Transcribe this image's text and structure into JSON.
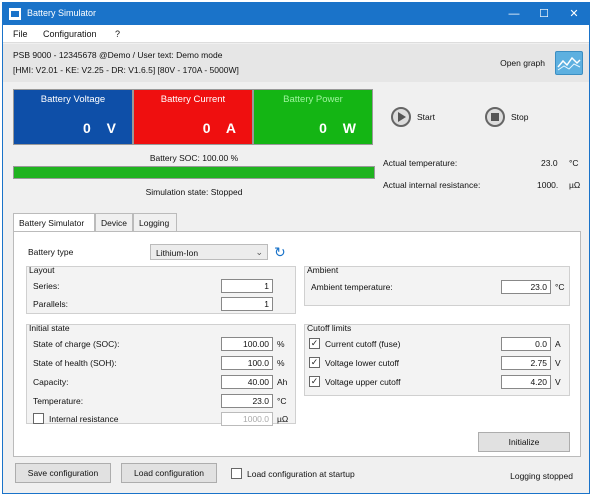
{
  "window": {
    "title": "Battery Simulator"
  },
  "menu": [
    "File",
    "Configuration",
    "?"
  ],
  "info": {
    "line1": "PSB 9000 - 12345678 @Demo / User text: Demo mode",
    "line2": "[HMI: V2.01 - KE: V2.25 - DR: V1.6.5] [80V - 170A - 5000W]",
    "open_graph": "Open graph"
  },
  "meters": [
    {
      "label": "Battery Voltage",
      "value": "0",
      "unit": "V",
      "color": "#0e4fa8",
      "label_color": "#ffffff"
    },
    {
      "label": "Battery Current",
      "value": "0",
      "unit": "A",
      "color": "#ef0f0f",
      "label_color": "#ffffff"
    },
    {
      "label": "Battery Power",
      "value": "0",
      "unit": "W",
      "color": "#14b514",
      "label_color": "#9ff59f"
    }
  ],
  "controls": {
    "start": "Start",
    "stop": "Stop"
  },
  "soc": {
    "label": "Battery SOC: 100.00 %",
    "percent": 100
  },
  "sim_state": "Simulation state: Stopped",
  "actuals": {
    "temp_label": "Actual temperature:",
    "temp_value": "23.0",
    "temp_unit": "°C",
    "res_label": "Actual internal resistance:",
    "res_value": "1000.",
    "res_unit": "µΩ"
  },
  "tabs": [
    "Battery Simulator",
    "Device",
    "Logging"
  ],
  "battery_type": {
    "label": "Battery type",
    "value": "Lithium-Ion"
  },
  "layout": {
    "title": "Layout",
    "series_label": "Series:",
    "series_value": "1",
    "parallels_label": "Parallels:",
    "parallels_value": "1"
  },
  "initial": {
    "title": "Initial state",
    "rows": [
      {
        "label": "State of charge (SOC):",
        "value": "100.00",
        "unit": "%"
      },
      {
        "label": "State of health (SOH):",
        "value": "100.0",
        "unit": "%"
      },
      {
        "label": "Capacity:",
        "value": "40.00",
        "unit": "Ah"
      },
      {
        "label": "Temperature:",
        "value": "23.0",
        "unit": "°C"
      }
    ],
    "ir_label": "Internal resistance",
    "ir_value": "1000.0",
    "ir_unit": "µΩ"
  },
  "ambient": {
    "title": "Ambient",
    "label": "Ambient temperature:",
    "value": "23.0",
    "unit": "°C"
  },
  "cutoff": {
    "title": "Cutoff limits",
    "rows": [
      {
        "label": "Current cutoff (fuse)",
        "value": "0.0",
        "unit": "A"
      },
      {
        "label": "Voltage lower cutoff",
        "value": "2.75",
        "unit": "V"
      },
      {
        "label": "Voltage upper cutoff",
        "value": "4.20",
        "unit": "V"
      }
    ]
  },
  "initialize": "Initialize",
  "footer": {
    "save": "Save configuration",
    "load": "Load configuration",
    "load_startup": "Load configuration at startup",
    "logging": "Logging stopped"
  }
}
